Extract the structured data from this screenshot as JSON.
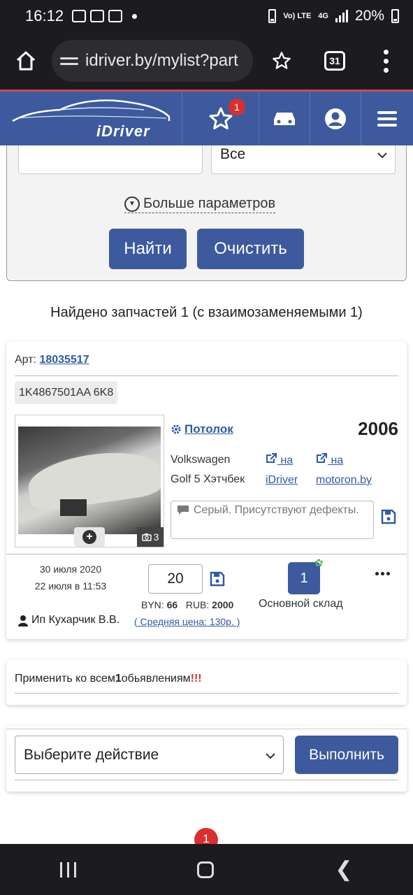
{
  "status_bar": {
    "time": "16:12",
    "network": "4G",
    "volte": "Vo) LTE",
    "battery": "20%"
  },
  "browser": {
    "url": "idriver.by/mylist?part",
    "tab_count": "31"
  },
  "header": {
    "logo_text": "iDriver",
    "favorites_badge": "1"
  },
  "filter": {
    "input_value": "",
    "select_value": "Все",
    "more_params": "Больше параметров",
    "find_label": "Найти",
    "clear_label": "Очистить"
  },
  "results": {
    "found_text": "Найдено запчастей 1 (с взаимозаменяемыми 1)"
  },
  "part": {
    "art_label": "Арт:",
    "art_number": "18035517",
    "oem_code": "1K4867501AA 6K8",
    "category": "Потолок",
    "year": "2006",
    "make": "Volkswagen",
    "model": "Golf 5 Хэтчбек",
    "link1_prefix": "на",
    "link1_site": "iDriver",
    "link2_prefix": "на",
    "link2_site": "motoron.by",
    "comment": "Серый. Присутствуют дефекты.",
    "photo_count": "3",
    "date_created": "30 июля 2020",
    "date_updated": "22 июля в 11:53",
    "price_value": "20",
    "byn_label": "BYN:",
    "byn_value": "66",
    "rub_label": "RUB:",
    "rub_value": "2000",
    "stock_count": "1",
    "stock_name": "Основной склад",
    "seller": "Ип Кухарчик В.В.",
    "avg_price": "( Средняя цена: 130р. )"
  },
  "apply": {
    "prefix": "Применить ко всем",
    "count": "1",
    "suffix": "обьявлениям",
    "marks": "!!!"
  },
  "action": {
    "select_placeholder": "Выберите действие",
    "execute_label": "Выполнить"
  },
  "pagination": {
    "current": "1"
  },
  "colors": {
    "brand": "#3d5a9e",
    "badge": "#d9302f",
    "link": "#2f5aa5"
  }
}
